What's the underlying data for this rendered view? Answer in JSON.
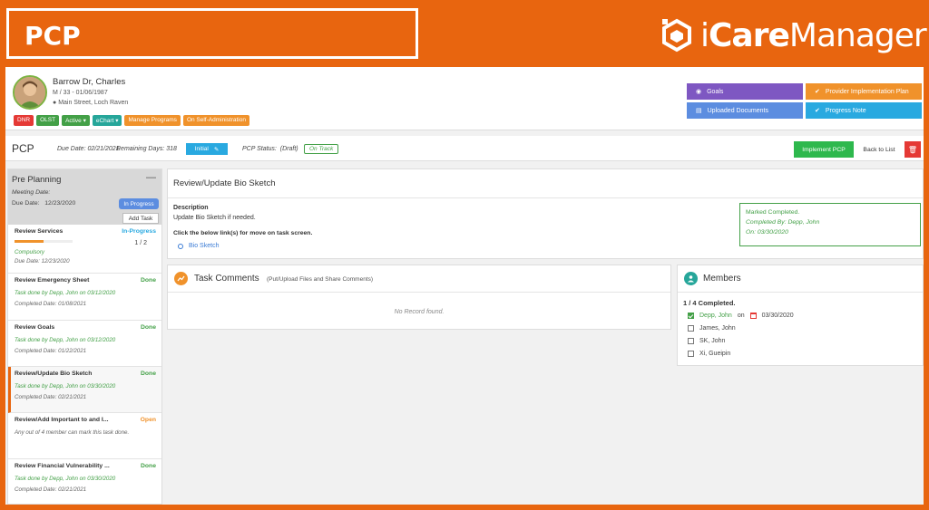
{
  "banner": {
    "title": "PCP",
    "brand_prefix": "i",
    "brand_bold": "Care",
    "brand_rest": "Manager"
  },
  "patient": {
    "name": "Barrow Dr, Charles",
    "meta": "M / 33 - 01/06/1987",
    "address": "Main Street, Loch Raven",
    "badges": [
      "DNR",
      "OLST",
      "Active",
      "eChart",
      "Manage Programs",
      "On Self-Administration"
    ]
  },
  "quick_actions": {
    "goals": "Goals",
    "provider_plan": "Provider Implementation Plan",
    "uploaded_docs": "Uploaded Documents",
    "progress_note": "Progress Note"
  },
  "pcp_bar": {
    "title": "PCP",
    "due_date_label": "Due Date:",
    "due_date": "02/21/2021",
    "remaining_label": "Remaining Days:",
    "remaining": "318",
    "initial": "Initial",
    "status_label": "PCP Status:",
    "status_draft": "(Draft)",
    "status": "On Track",
    "implement": "Implement PCP",
    "back": "Back to List"
  },
  "pre_planning": {
    "title": "Pre Planning",
    "meeting_label": "Meeting Date:",
    "due_label": "Due Date:",
    "due_date": "12/23/2020",
    "status": "In Progress",
    "add_task": "Add Task"
  },
  "tasks": [
    {
      "name": "Review Services",
      "status": "In-Progress",
      "progress_fraction": 0.5,
      "count": "1 / 2",
      "line1": "Compulsory",
      "line2": "Due Date:    12/23/2020"
    },
    {
      "name": "Review Emergency Sheet",
      "status": "Done",
      "line1": "Task done by Depp, John on 03/12/2020",
      "line2": "Completed Date:    01/08/2021"
    },
    {
      "name": "Review Goals",
      "status": "Done",
      "line1": "Task done by Depp, John on 03/12/2020",
      "line2": "Completed Date:    01/22/2021"
    },
    {
      "name": "Review/Update Bio Sketch",
      "status": "Done",
      "line1": "Task done by Depp, John on 03/30/2020",
      "line2": "Completed Date:    02/21/2021"
    },
    {
      "name": "Review/Add Important to and I...",
      "status": "Open",
      "line1": "Any out of 4 member can mark this task done."
    },
    {
      "name": "Review Financial Vulnerability ...",
      "status": "Done",
      "line1": "Task done by Depp, John on 03/30/2020",
      "line2": "Completed Date:    02/21/2021"
    }
  ],
  "review": {
    "title": "Review/Update Bio Sketch",
    "desc_label": "Description",
    "desc": "Update Bio Sketch if needed.",
    "click_hint": "Click the below link(s) for move on task screen.",
    "link": "Bio Sketch",
    "completed_title": "Marked Completed.",
    "completed_by": "Completed By:  Depp, John",
    "completed_on": "On:  03/30/2020"
  },
  "comments": {
    "title": "Task Comments",
    "subtitle": "(Put/Upload Files and Share Comments)",
    "empty": "No Record found."
  },
  "members": {
    "title": "Members",
    "completed": "1 / 4 Completed.",
    "list": [
      {
        "name": "Depp, John",
        "checked": true,
        "on": "on",
        "date": "03/30/2020"
      },
      {
        "name": "James, John",
        "checked": false
      },
      {
        "name": "SK, John",
        "checked": false
      },
      {
        "name": "Xi, Gueipin",
        "checked": false
      }
    ]
  },
  "colors": {
    "banner": "#e8650f",
    "green": "#43a047",
    "blue": "#29a9e0",
    "orange": "#f0922b"
  }
}
